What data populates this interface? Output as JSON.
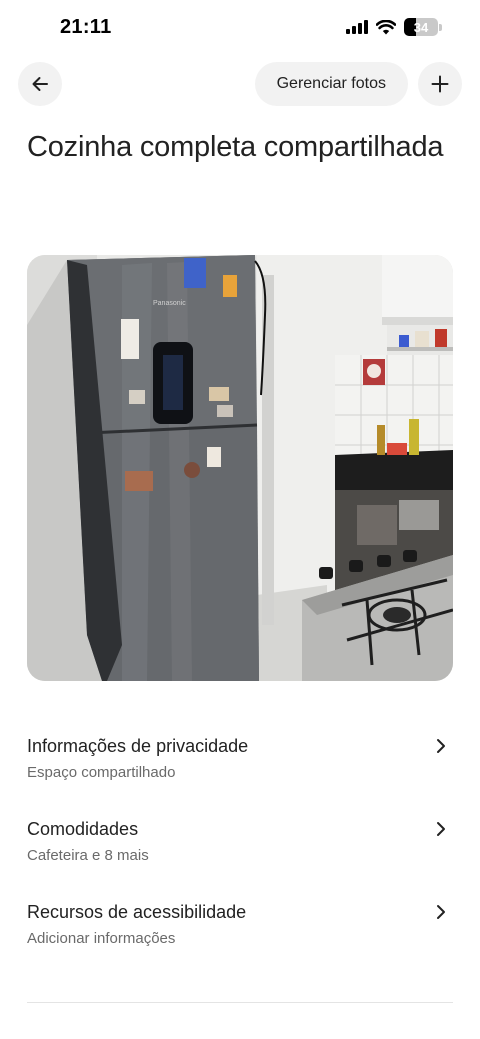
{
  "status": {
    "time": "21:11",
    "battery": "34"
  },
  "nav": {
    "manage_photos_label": "Gerenciar fotos"
  },
  "page": {
    "title": "Cozinha completa compartilhada"
  },
  "rows": [
    {
      "title": "Informações de privacidade",
      "subtitle": "Espaço compartilhado"
    },
    {
      "title": "Comodidades",
      "subtitle": "Cafeteira e 8 mais"
    },
    {
      "title": "Recursos de acessibilidade",
      "subtitle": "Adicionar informações"
    }
  ],
  "photo": {
    "brand": "Panasonic"
  },
  "icons": {
    "back": "arrow-left-icon",
    "add": "plus-icon",
    "chevron": "chevron-right-icon"
  }
}
